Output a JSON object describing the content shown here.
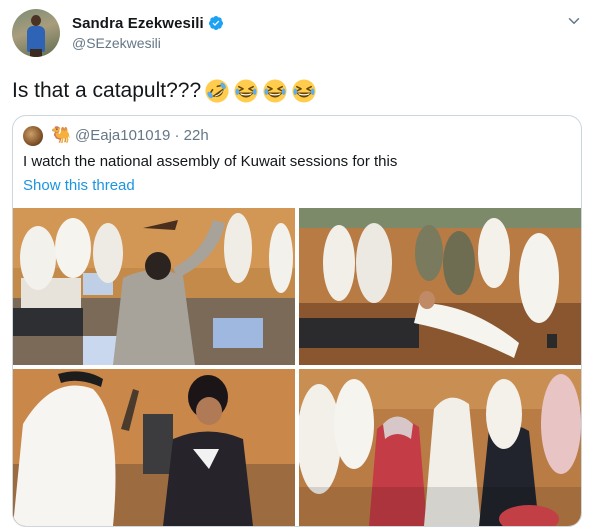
{
  "tweet": {
    "display_name": "Sandra Ezekwesili",
    "handle": "@SEzekwesili",
    "text": "Is that a catapult???",
    "emojis": [
      "rolling-on-floor-laughing-emoji",
      "grinning-squinting-emoji",
      "grinning-squinting-emoji",
      "grinning-squinting-emoji"
    ]
  },
  "quoted": {
    "handle_line": "@Eaja101019 · 22h",
    "text": "I watch the national assembly of Kuwait sessions for this",
    "show_thread": "Show this thread"
  },
  "colors": {
    "link": "#1b95e0",
    "verified": "#1da1f2",
    "secondary_text": "#657786",
    "border": "#ccd6dd"
  },
  "icons": [
    "verified-badge-icon",
    "chevron-down-icon",
    "camel-icon"
  ]
}
